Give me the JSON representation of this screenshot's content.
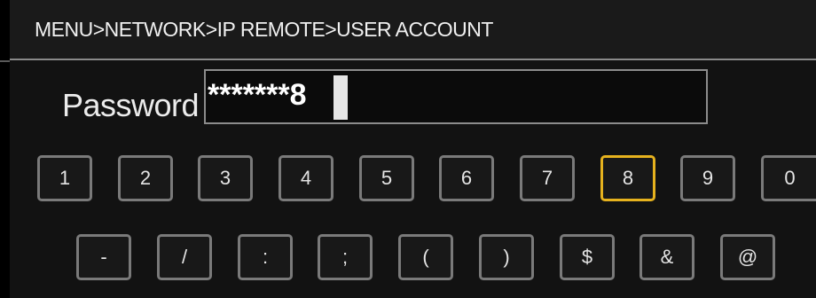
{
  "header": {
    "breadcrumb": "MENU>NETWORK>IP REMOTE>USER ACCOUNT"
  },
  "password": {
    "label": "Password",
    "value": "*******8"
  },
  "keyboard": {
    "row1": [
      "1",
      "2",
      "3",
      "4",
      "5",
      "6",
      "7",
      "8",
      "9",
      "0"
    ],
    "row2": [
      "-",
      "/",
      ":",
      ";",
      "(",
      ")",
      "$",
      "&",
      "@"
    ],
    "selected_key": "8",
    "selection_color": "#e6b21e"
  }
}
